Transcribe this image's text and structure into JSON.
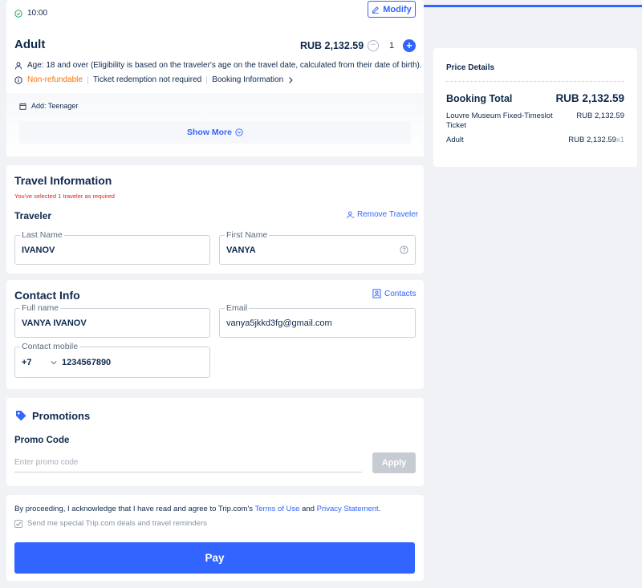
{
  "ticket": {
    "time": "10:00",
    "modify_label": "Modify",
    "adult_title": "Adult",
    "price": "RUB 2,132.59",
    "quantity": "1",
    "age_text": "Age: 18 and over (Eligibility is based on the traveler's age on the travel date, calculated from their date of birth).",
    "non_refundable": "Non-refundable",
    "ticket_redemption": "Ticket redemption not required",
    "booking_information": "Booking Information",
    "addon": "Add: Teenager",
    "show_more": "Show More"
  },
  "travel": {
    "title": "Travel Information",
    "note": "You've selected 1 traveler as required",
    "traveler_label": "Traveler",
    "remove_traveler": "Remove Traveler",
    "last_name_label": "Last Name",
    "last_name_value": "IVANOV",
    "first_name_label": "First Name",
    "first_name_value": "VANYA"
  },
  "contact": {
    "title": "Contact Info",
    "contacts_link": "Contacts",
    "full_name_label": "Full name",
    "full_name_value": "VANYA IVANOV",
    "email_label": "Email",
    "email_value": "vanya5jkkd3fg@gmail.com",
    "mobile_label": "Contact mobile",
    "country_code": "+7",
    "mobile_value": "1234567890"
  },
  "promo": {
    "title": "Promotions",
    "code_label": "Promo Code",
    "placeholder": "Enter promo code",
    "apply_label": "Apply"
  },
  "agreement": {
    "prefix": "By proceeding, I acknowledge that I have read and agree to Trip.com's ",
    "terms": "Terms of Use",
    "and": " and ",
    "privacy": "Privacy Statement",
    "suffix": ".",
    "deals": "Send me special Trip.com deals and travel reminders",
    "pay_label": "Pay"
  },
  "price_details": {
    "title": "Price Details",
    "total_label": "Booking Total",
    "total_value": "RUB 2,132.59",
    "item_name": "Louvre Museum Fixed-Timeslot Ticket",
    "item_price": "RUB 2,132.59",
    "adult_label": "Adult",
    "adult_price": "RUB 2,132.59",
    "adult_qty": "x1"
  },
  "colors": {
    "accent": "#3264ff",
    "warning": "#ff6f00",
    "error": "#e02020",
    "text": "#0f294d"
  }
}
